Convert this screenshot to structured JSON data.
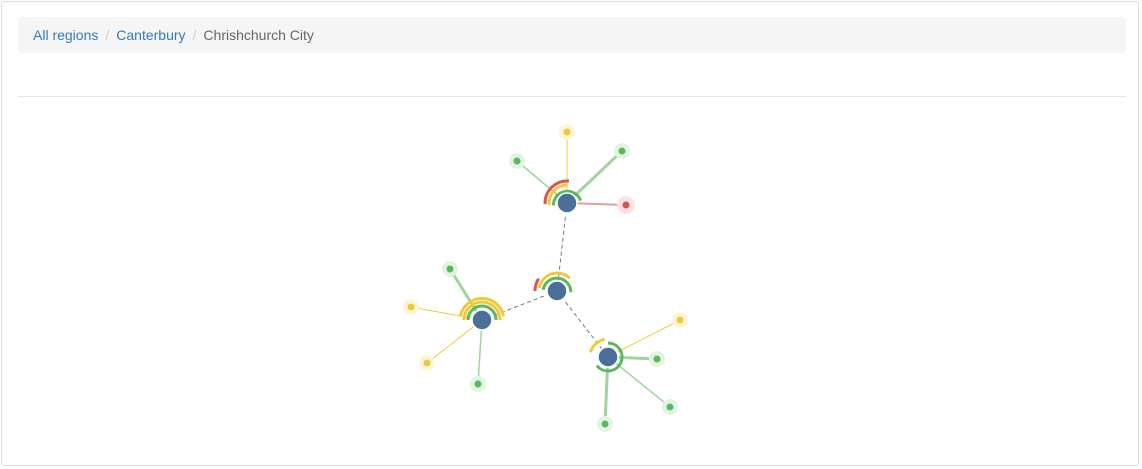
{
  "breadcrumb": {
    "items": [
      {
        "label": "All regions",
        "active": false
      },
      {
        "label": "Canterbury",
        "active": false
      },
      {
        "label": "Chrishchurch City",
        "active": true
      }
    ],
    "separator": "/"
  },
  "colors": {
    "hub": "#4a6f99",
    "good": "#5cb85c",
    "warn": "#f0c93a",
    "bad": "#d9534f",
    "link": "#777777"
  }
}
